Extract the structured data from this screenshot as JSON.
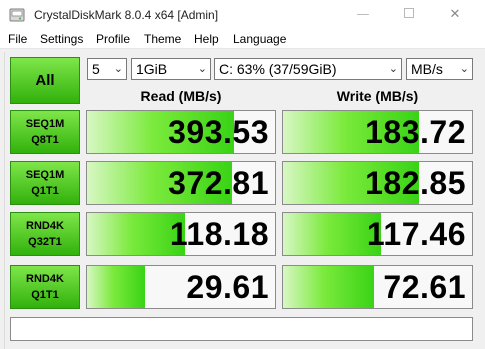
{
  "window": {
    "title": "CrystalDiskMark 8.0.4 x64 [Admin]",
    "controls": {
      "minimize": "—",
      "close": "✕"
    }
  },
  "menu": [
    "File",
    "Settings",
    "Profile",
    "Theme",
    "Help",
    "Language"
  ],
  "controls": {
    "all_label": "All",
    "count": "5",
    "size": "1GiB",
    "drive": "C: 63% (37/59GiB)",
    "unit": "MB/s"
  },
  "headers": {
    "read": "Read (MB/s)",
    "write": "Write (MB/s)"
  },
  "tests": [
    {
      "line1": "SEQ1M",
      "line2": "Q8T1",
      "read": "393.53",
      "write": "183.72",
      "read_fill": 0.78,
      "write_fill": 0.72
    },
    {
      "line1": "SEQ1M",
      "line2": "Q1T1",
      "read": "372.81",
      "write": "182.85",
      "read_fill": 0.77,
      "write_fill": 0.72
    },
    {
      "line1": "RND4K",
      "line2": "Q32T1",
      "read": "118.18",
      "write": "117.46",
      "read_fill": 0.52,
      "write_fill": 0.52
    },
    {
      "line1": "RND4K",
      "line2": "Q1T1",
      "read": "29.61",
      "write": "72.61",
      "read_fill": 0.31,
      "write_fill": 0.48
    }
  ],
  "comment": ""
}
